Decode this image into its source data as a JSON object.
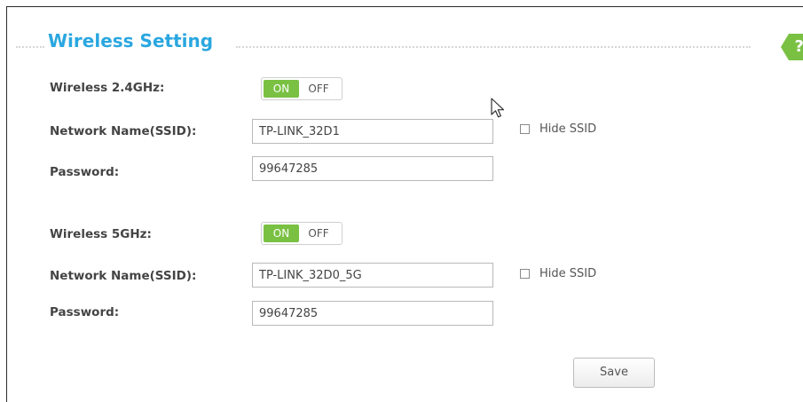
{
  "section": {
    "title": "Wireless Setting",
    "help_icon_text": "?"
  },
  "band24": {
    "label": "Wireless 2.4GHz:",
    "toggle_on": "ON",
    "toggle_off": "OFF",
    "state": "on",
    "ssid_label": "Network Name(SSID):",
    "ssid_value": "TP-LINK_32D1",
    "hide_ssid_label": "Hide SSID",
    "hide_ssid_checked": false,
    "password_label": "Password:",
    "password_value": "99647285"
  },
  "band5": {
    "label": "Wireless 5GHz:",
    "toggle_on": "ON",
    "toggle_off": "OFF",
    "state": "on",
    "ssid_label": "Network Name(SSID):",
    "ssid_value": "TP-LINK_32D0_5G",
    "hide_ssid_label": "Hide SSID",
    "hide_ssid_checked": false,
    "password_label": "Password:",
    "password_value": "99647285"
  },
  "actions": {
    "save_label": "Save"
  },
  "colors": {
    "accent": "#2aa7e0",
    "toggle_on": "#7ac143"
  },
  "icons": [
    "help-icon",
    "mouse-pointer-icon"
  ]
}
